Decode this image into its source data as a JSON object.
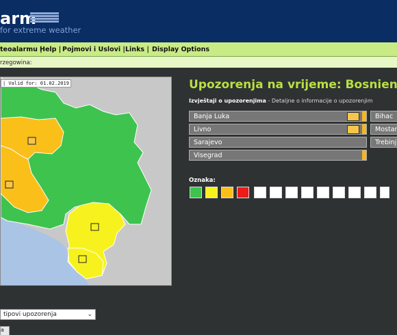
{
  "header": {
    "logo_text": "arm",
    "tagline": "for extreme weather"
  },
  "nav": {
    "items": [
      "teoalarmu |",
      "Help |",
      "Pojmovi i Uslovi |",
      "Links |",
      "Display Options"
    ]
  },
  "breadcrumb": "rzegowina:",
  "map": {
    "valid_label": "| Valid for: 01.02.2019",
    "colors": {
      "green": "#3ec34f",
      "orange": "#fbbf1a",
      "yellow": "#f7f21e",
      "sea": "#aac4e6",
      "land": "#c8c8c8"
    }
  },
  "page_title": "Upozorenja na vrijeme: Bosnien",
  "subheading": {
    "bold": "Izvještaji o upozorenjima",
    "rest": " - Detaljne o informacije o upozorenjim"
  },
  "regions": [
    {
      "name": "Banja Luka",
      "icon": "wind-icon"
    },
    {
      "name": "Bihac",
      "icon": ""
    },
    {
      "name": "Livno",
      "icon": "wind-icon"
    },
    {
      "name": "Mostar",
      "icon": ""
    },
    {
      "name": "Sarajevo",
      "icon": ""
    },
    {
      "name": "Trebinj",
      "icon": ""
    },
    {
      "name": "Visegrad",
      "icon": ""
    }
  ],
  "legend": {
    "label": "Oznaka:",
    "level_colors": [
      "#3ec34f",
      "#f7f21e",
      "#fbbf1a",
      "#ee1b1b"
    ],
    "icons": [
      "wind-icon",
      "snow-ice-icon",
      "thunderstorm-icon",
      "fog-icon",
      "extreme-high-temperature-icon",
      "extreme-low-temperature-icon",
      "coastal-event-icon",
      "forest-fire-icon",
      "avalanche-icon"
    ]
  },
  "filter": {
    "selected": "tipovi upozorenja"
  },
  "submit_label": "a"
}
